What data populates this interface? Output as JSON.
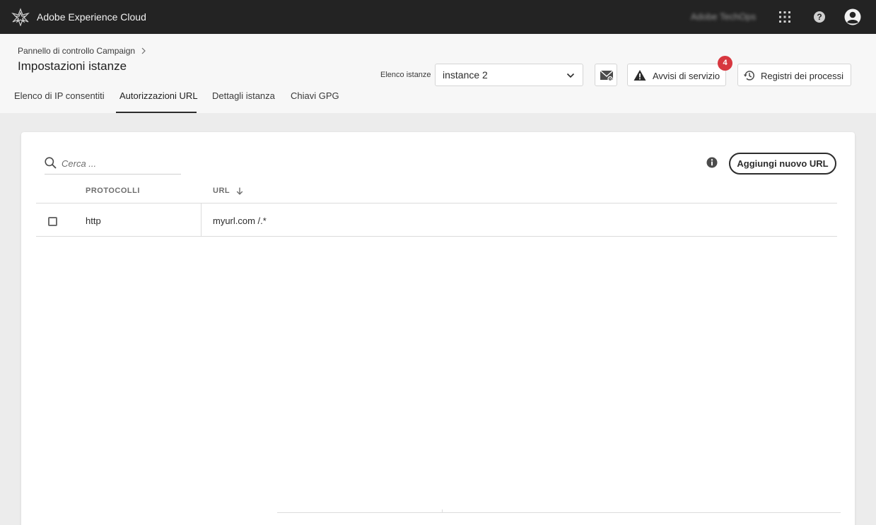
{
  "shell": {
    "app_title": "Adobe Experience Cloud",
    "org_name": "Adobe TechOps",
    "icons": [
      "adobe-experience-cloud-logo",
      "apps-grid-icon",
      "help-icon",
      "user-avatar-icon"
    ]
  },
  "header": {
    "breadcrumb": "Pannello di controllo Campaign",
    "title": "Impostazioni istanze",
    "instance_label": "Elenco istanze",
    "instance_selected": "instance 2",
    "alerts_label": "Avvisi di servizio",
    "alerts_count": "4",
    "logs_label": "Registri dei processi"
  },
  "tabs": [
    {
      "label": "Elenco di IP consentiti",
      "active": false
    },
    {
      "label": "Autorizzazioni URL",
      "active": true
    },
    {
      "label": "Dettagli istanza",
      "active": false
    },
    {
      "label": "Chiavi GPG",
      "active": false
    }
  ],
  "content": {
    "search_placeholder": "Cerca ...",
    "add_button": "Aggiungi nuovo URL",
    "columns": {
      "protocol": "PROTOCOLLI",
      "url": "URL"
    },
    "sort_indicator": "descending",
    "rows": [
      {
        "protocol": "http",
        "url": "myurl.com /.*"
      }
    ]
  },
  "colors": {
    "shell_bg": "#232323",
    "badge": "#d7373f",
    "page_bg": "#ececec"
  }
}
